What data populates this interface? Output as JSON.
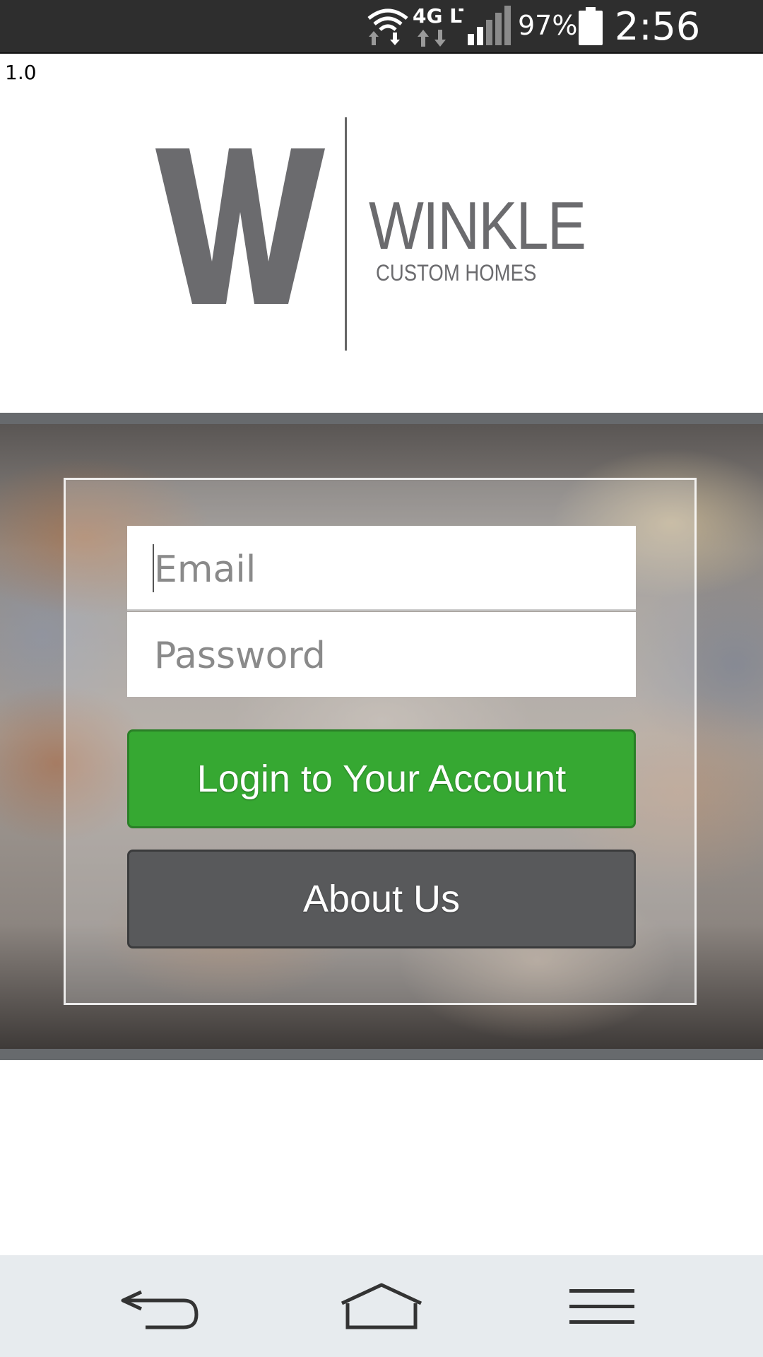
{
  "status_bar": {
    "network_label": "4G LTE",
    "battery_percent": "97%",
    "time": "2:56 PM",
    "icons": [
      "wifi-icon",
      "lte-data-icon",
      "signal-icon",
      "battery-icon"
    ]
  },
  "app": {
    "version": "1.0",
    "logo": {
      "letter": "W",
      "name": "WINKLE",
      "tagline": "CUSTOM HOMES"
    }
  },
  "login_form": {
    "email_placeholder": "Email",
    "password_placeholder": "Password",
    "login_button_label": "Login to Your Account",
    "about_button_label": "About Us"
  },
  "nav_bar": {
    "icons": [
      "back-icon",
      "home-icon",
      "menu-icon"
    ]
  },
  "colors": {
    "status_bar": "#2e2e2e",
    "logo_gray": "#6b6b6e",
    "login_green": "#36a832",
    "about_gray": "#58595b",
    "nav_bar": "#e7ebee"
  }
}
